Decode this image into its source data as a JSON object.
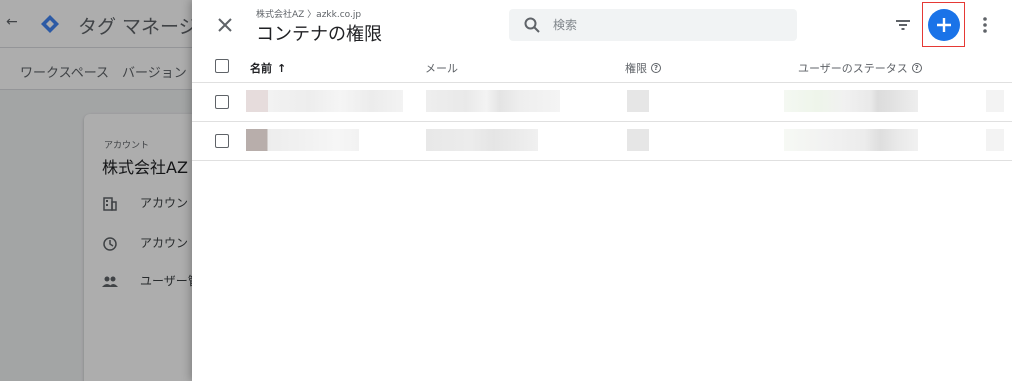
{
  "background": {
    "app_title": "タグ マネージャー",
    "subnav": [
      "ワークスペース",
      "バージョン"
    ],
    "account_label": "アカウント",
    "account_name": "株式会社AZ",
    "menu_items": [
      "アカウント詳細",
      "アカウントのアクティビティ",
      "ユーザー管理"
    ]
  },
  "panel": {
    "breadcrumb": "株式会社AZ 〉azkk.co.jp",
    "title": "コンテナの権限",
    "search_placeholder": "検索",
    "search_value": ""
  },
  "table": {
    "columns": {
      "name": "名前",
      "email": "メール",
      "permission": "権限",
      "status": "ユーザーのステータス"
    },
    "sort_indicator": "↑"
  },
  "colors": {
    "accent": "#1a73e8",
    "highlight_border": "#e53935",
    "scrim": "rgba(0,0,0,0.32)"
  },
  "icons": [
    "back-arrow-icon",
    "gtm-logo-icon",
    "close-icon",
    "search-icon",
    "filter-icon",
    "plus-icon",
    "more-vert-icon",
    "help-icon",
    "sort-arrow-icon",
    "building-icon",
    "history-icon",
    "people-icon"
  ]
}
